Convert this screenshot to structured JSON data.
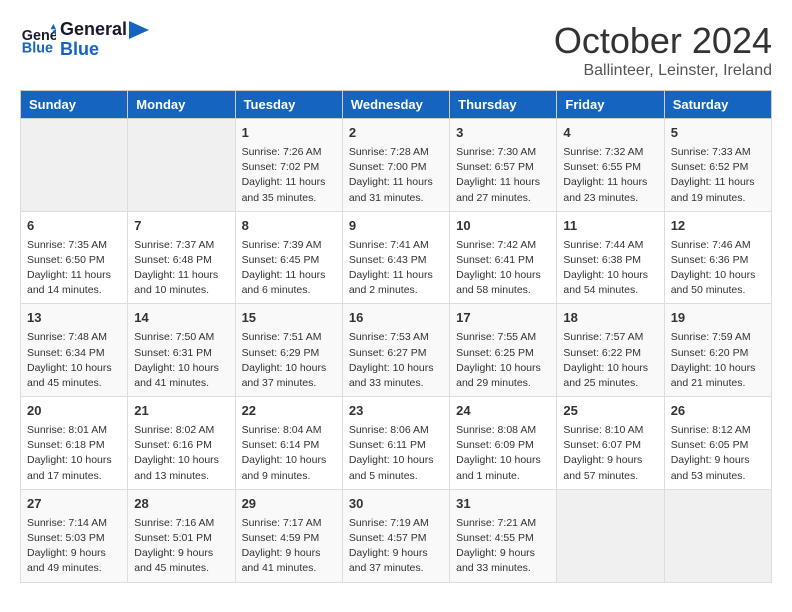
{
  "header": {
    "logo_line1": "General",
    "logo_line2": "Blue",
    "month": "October 2024",
    "location": "Ballinteer, Leinster, Ireland"
  },
  "days_of_week": [
    "Sunday",
    "Monday",
    "Tuesday",
    "Wednesday",
    "Thursday",
    "Friday",
    "Saturday"
  ],
  "weeks": [
    [
      {
        "day": "",
        "info": ""
      },
      {
        "day": "",
        "info": ""
      },
      {
        "day": "1",
        "info": "Sunrise: 7:26 AM\nSunset: 7:02 PM\nDaylight: 11 hours and 35 minutes."
      },
      {
        "day": "2",
        "info": "Sunrise: 7:28 AM\nSunset: 7:00 PM\nDaylight: 11 hours and 31 minutes."
      },
      {
        "day": "3",
        "info": "Sunrise: 7:30 AM\nSunset: 6:57 PM\nDaylight: 11 hours and 27 minutes."
      },
      {
        "day": "4",
        "info": "Sunrise: 7:32 AM\nSunset: 6:55 PM\nDaylight: 11 hours and 23 minutes."
      },
      {
        "day": "5",
        "info": "Sunrise: 7:33 AM\nSunset: 6:52 PM\nDaylight: 11 hours and 19 minutes."
      }
    ],
    [
      {
        "day": "6",
        "info": "Sunrise: 7:35 AM\nSunset: 6:50 PM\nDaylight: 11 hours and 14 minutes."
      },
      {
        "day": "7",
        "info": "Sunrise: 7:37 AM\nSunset: 6:48 PM\nDaylight: 11 hours and 10 minutes."
      },
      {
        "day": "8",
        "info": "Sunrise: 7:39 AM\nSunset: 6:45 PM\nDaylight: 11 hours and 6 minutes."
      },
      {
        "day": "9",
        "info": "Sunrise: 7:41 AM\nSunset: 6:43 PM\nDaylight: 11 hours and 2 minutes."
      },
      {
        "day": "10",
        "info": "Sunrise: 7:42 AM\nSunset: 6:41 PM\nDaylight: 10 hours and 58 minutes."
      },
      {
        "day": "11",
        "info": "Sunrise: 7:44 AM\nSunset: 6:38 PM\nDaylight: 10 hours and 54 minutes."
      },
      {
        "day": "12",
        "info": "Sunrise: 7:46 AM\nSunset: 6:36 PM\nDaylight: 10 hours and 50 minutes."
      }
    ],
    [
      {
        "day": "13",
        "info": "Sunrise: 7:48 AM\nSunset: 6:34 PM\nDaylight: 10 hours and 45 minutes."
      },
      {
        "day": "14",
        "info": "Sunrise: 7:50 AM\nSunset: 6:31 PM\nDaylight: 10 hours and 41 minutes."
      },
      {
        "day": "15",
        "info": "Sunrise: 7:51 AM\nSunset: 6:29 PM\nDaylight: 10 hours and 37 minutes."
      },
      {
        "day": "16",
        "info": "Sunrise: 7:53 AM\nSunset: 6:27 PM\nDaylight: 10 hours and 33 minutes."
      },
      {
        "day": "17",
        "info": "Sunrise: 7:55 AM\nSunset: 6:25 PM\nDaylight: 10 hours and 29 minutes."
      },
      {
        "day": "18",
        "info": "Sunrise: 7:57 AM\nSunset: 6:22 PM\nDaylight: 10 hours and 25 minutes."
      },
      {
        "day": "19",
        "info": "Sunrise: 7:59 AM\nSunset: 6:20 PM\nDaylight: 10 hours and 21 minutes."
      }
    ],
    [
      {
        "day": "20",
        "info": "Sunrise: 8:01 AM\nSunset: 6:18 PM\nDaylight: 10 hours and 17 minutes."
      },
      {
        "day": "21",
        "info": "Sunrise: 8:02 AM\nSunset: 6:16 PM\nDaylight: 10 hours and 13 minutes."
      },
      {
        "day": "22",
        "info": "Sunrise: 8:04 AM\nSunset: 6:14 PM\nDaylight: 10 hours and 9 minutes."
      },
      {
        "day": "23",
        "info": "Sunrise: 8:06 AM\nSunset: 6:11 PM\nDaylight: 10 hours and 5 minutes."
      },
      {
        "day": "24",
        "info": "Sunrise: 8:08 AM\nSunset: 6:09 PM\nDaylight: 10 hours and 1 minute."
      },
      {
        "day": "25",
        "info": "Sunrise: 8:10 AM\nSunset: 6:07 PM\nDaylight: 9 hours and 57 minutes."
      },
      {
        "day": "26",
        "info": "Sunrise: 8:12 AM\nSunset: 6:05 PM\nDaylight: 9 hours and 53 minutes."
      }
    ],
    [
      {
        "day": "27",
        "info": "Sunrise: 7:14 AM\nSunset: 5:03 PM\nDaylight: 9 hours and 49 minutes."
      },
      {
        "day": "28",
        "info": "Sunrise: 7:16 AM\nSunset: 5:01 PM\nDaylight: 9 hours and 45 minutes."
      },
      {
        "day": "29",
        "info": "Sunrise: 7:17 AM\nSunset: 4:59 PM\nDaylight: 9 hours and 41 minutes."
      },
      {
        "day": "30",
        "info": "Sunrise: 7:19 AM\nSunset: 4:57 PM\nDaylight: 9 hours and 37 minutes."
      },
      {
        "day": "31",
        "info": "Sunrise: 7:21 AM\nSunset: 4:55 PM\nDaylight: 9 hours and 33 minutes."
      },
      {
        "day": "",
        "info": ""
      },
      {
        "day": "",
        "info": ""
      }
    ]
  ]
}
